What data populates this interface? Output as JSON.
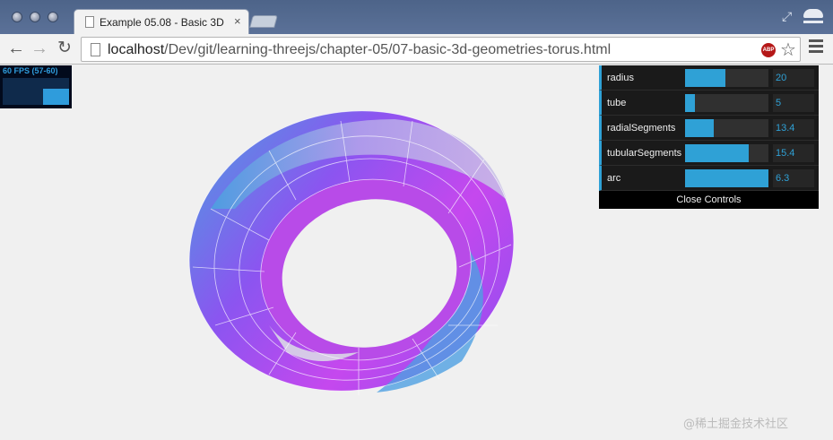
{
  "browser": {
    "tab_title": "Example 05.08 - Basic 3D",
    "tab_close": "×",
    "url_host": "localhost",
    "url_path": "/Dev/git/learning-threejs/chapter-05/07-basic-3d-geometries-torus.html",
    "abp_label": "ABP",
    "icons": [
      "back-arrow-icon",
      "forward-arrow-icon",
      "reload-icon",
      "page-icon",
      "abp-icon",
      "star-icon",
      "menu-icon",
      "incognito-icon"
    ]
  },
  "stats": {
    "fps_text": "60 FPS (57-60)"
  },
  "controls": {
    "rows": [
      {
        "label": "radius",
        "value": "20",
        "fill": 0.48
      },
      {
        "label": "tube",
        "value": "5",
        "fill": 0.12
      },
      {
        "label": "radialSegments",
        "value": "13.4",
        "fill": 0.34
      },
      {
        "label": "tubularSegments",
        "value": "15.4",
        "fill": 0.76
      },
      {
        "label": "arc",
        "value": "6.3",
        "fill": 1.0
      }
    ],
    "close_label": "Close Controls",
    "accent": "#2fa1d6"
  },
  "scene": {
    "colors": [
      "#4b9fe0",
      "#8b55f0",
      "#c548ee",
      "#b7b5e6"
    ]
  },
  "watermark": "@稀土掘金技术社区"
}
